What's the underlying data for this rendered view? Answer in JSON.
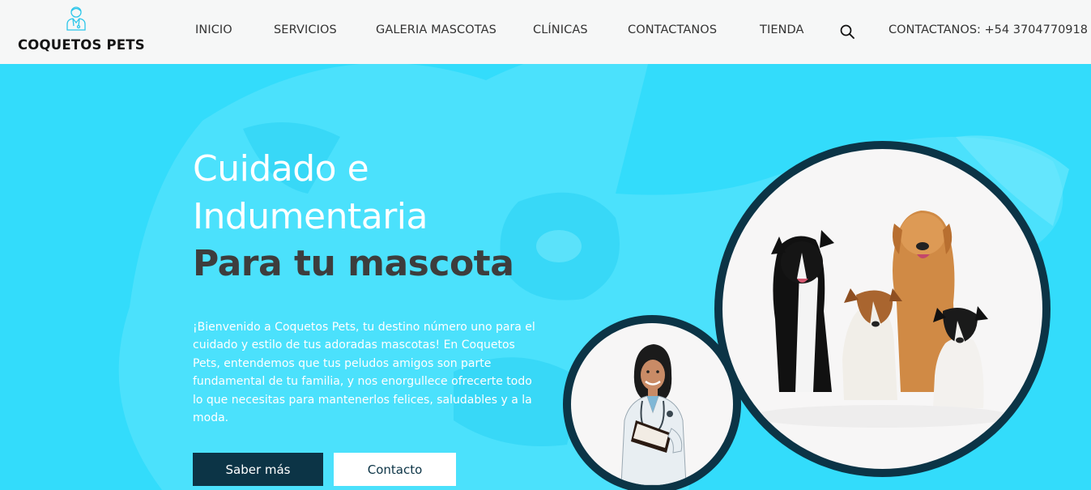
{
  "brand": {
    "name": "COQUETOS PETS",
    "icon": "veterinarian-icon"
  },
  "nav": {
    "items": [
      "INICIO",
      "SERVICIOS",
      "GALERIA MASCOTAS",
      "CLÍNICAS",
      "CONTACTANOS",
      "TIENDA"
    ],
    "search_icon": "search-icon",
    "contact": "CONTACTANOS: +54 3704770918"
  },
  "hero": {
    "title_line1": "Cuidado e",
    "title_line2": "Indumentaria",
    "title_strong": "Para tu mascota",
    "intro": "¡Bienvenido a Coquetos Pets, tu destino número uno para el cuidado y estilo de tus adoradas mascotas! En Coquetos Pets, entendemos que tus peludos amigos son parte fundamental de tu familia, y nos enorgullece ofrecerte todo lo que necesitas para mantenerlos felices, saludables y a la moda.",
    "primary_button": "Saber más",
    "secondary_button": "Contacto"
  },
  "colors": {
    "hero_background": "#33dcfb",
    "dark_accent": "#0c3446",
    "header_background": "#f6f7f7",
    "title_dark": "#3d3d3d"
  }
}
